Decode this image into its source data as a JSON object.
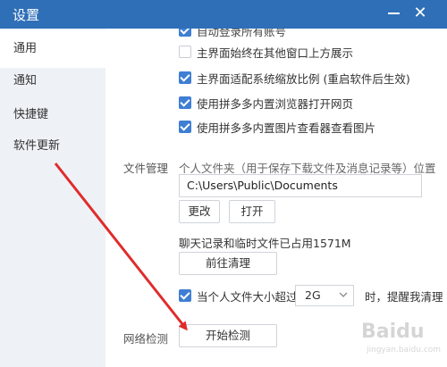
{
  "window": {
    "title": "设置"
  },
  "sidebar": {
    "items": [
      {
        "label": "通用",
        "active": true
      },
      {
        "label": "通知",
        "active": false
      },
      {
        "label": "快捷键",
        "active": false
      },
      {
        "label": "软件更新",
        "active": false
      }
    ]
  },
  "general": {
    "options": [
      {
        "label": "自动登录所有账号",
        "checked": true
      },
      {
        "label": "主界面始终在其他窗口上方展示",
        "checked": false
      },
      {
        "label": "主界面适配系统缩放比例 (重启软件后生效)",
        "checked": true
      },
      {
        "label": "使用拼多多内置浏览器打开网页",
        "checked": true
      },
      {
        "label": "使用拼多多内置图片查看器查看图片",
        "checked": true
      }
    ],
    "file_management": {
      "section_label": "文件管理",
      "folder_desc": "个人文件夹（用于保存下载文件及消息记录等）位置",
      "path_value": "C:\\Users\\Public\\Documents",
      "change_button": "更改",
      "open_button": "打开",
      "usage_text": "聊天记录和临时文件已占用1571M",
      "clean_button": "前往清理",
      "size_alert": {
        "checked": true,
        "label_prefix": "当个人文件大小超过",
        "selected_size": "2G",
        "label_suffix": "时，提醒我清理"
      }
    },
    "network": {
      "section_label": "网络检测",
      "start_button": "开始检测"
    }
  },
  "watermark": {
    "text": "Baidu",
    "sub": "jingyan.baidu.com"
  },
  "colors": {
    "titlebar": "#2f6fb8",
    "checkbox_on": "#3e7ed3",
    "sidebar_bg": "#eef2f7",
    "annotation_arrow": "#e02b2b"
  }
}
